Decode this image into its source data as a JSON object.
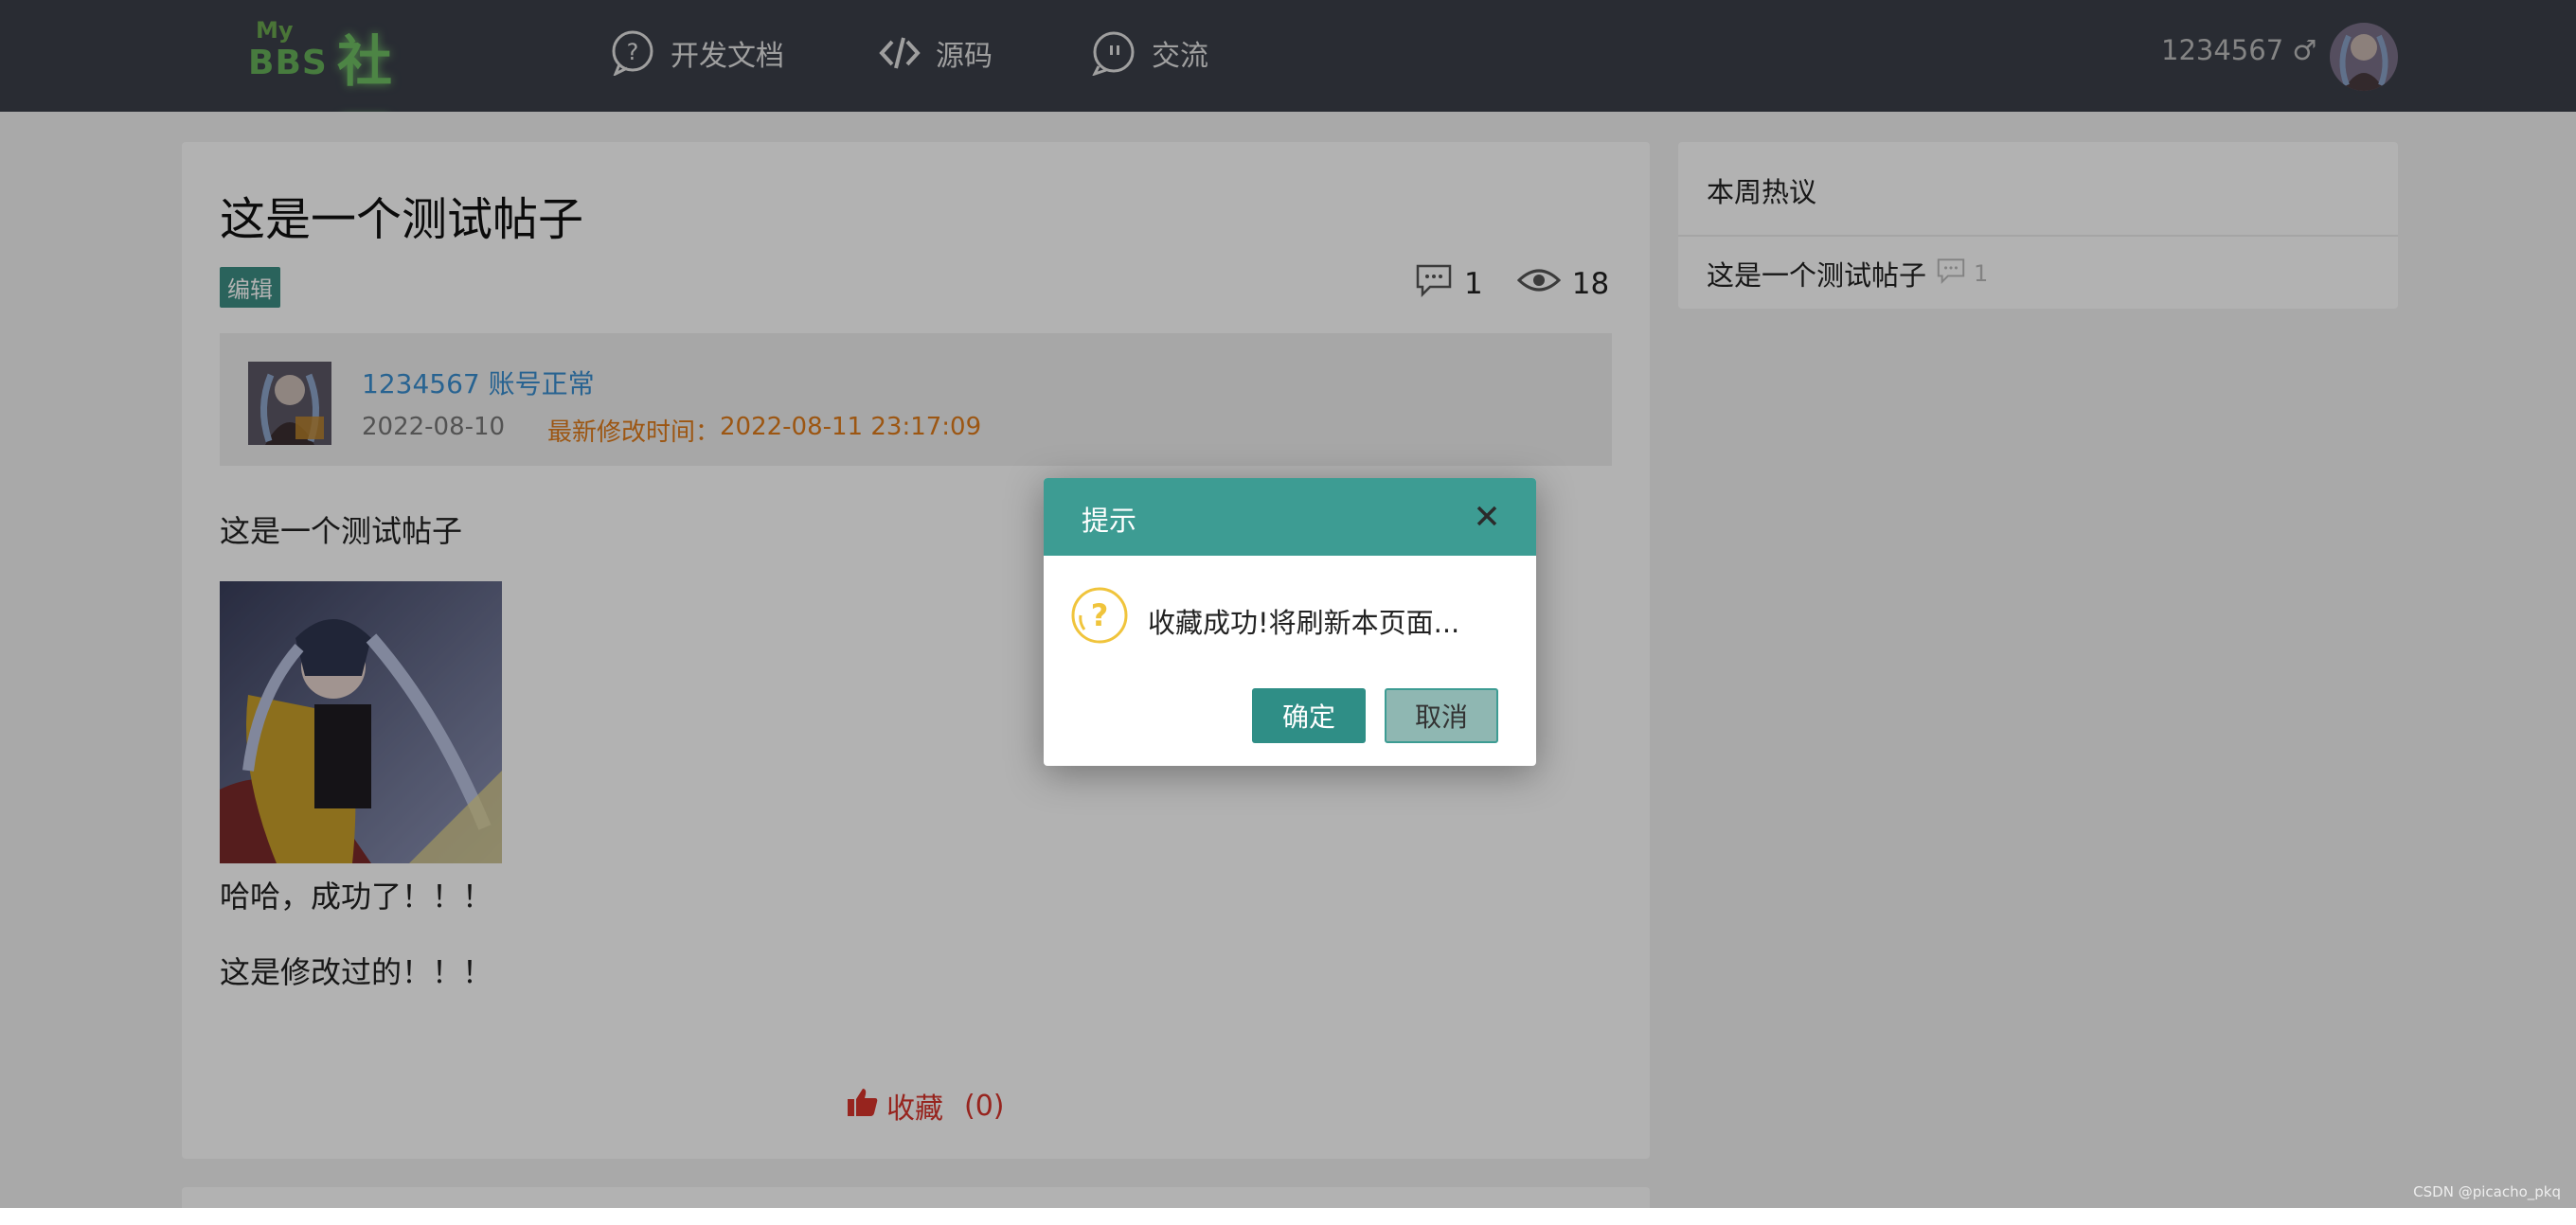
{
  "header": {
    "logo_my": "My",
    "logo_bbs": "BBS",
    "logo_cn": "社区",
    "nav": [
      {
        "label": "开发文档",
        "icon": "question-bubble-icon"
      },
      {
        "label": "源码",
        "icon": "code-icon"
      },
      {
        "label": "交流",
        "icon": "chat-icon"
      }
    ],
    "username": "1234567 ♂"
  },
  "post": {
    "title": "这是一个测试帖子",
    "edit_tag": "编辑",
    "comment_count": "1",
    "view_count": "18",
    "author": {
      "name_status": "1234567 账号正常",
      "created": "2022-08-10",
      "modified_label": "最新修改时间：",
      "modified": "2022-08-11 23:17:09"
    },
    "content": {
      "para1": "这是一个测试帖子",
      "para2": "哈哈，成功了！！！",
      "para3": "这是修改过的！！！"
    },
    "favorite_label": "收藏",
    "favorite_count": "(0)"
  },
  "sidebar": {
    "title": "本周热议",
    "items": [
      {
        "title": "这是一个测试帖子",
        "comments": "1"
      }
    ]
  },
  "modal": {
    "title": "提示",
    "message": "收藏成功!将刷新本页面...",
    "ok_label": "确定",
    "cancel_label": "取消"
  },
  "watermark": "CSDN @picacho_pkq",
  "colors": {
    "topbar": "#3b3f4a",
    "accent": "#3d9c93",
    "favorite": "#d9342b",
    "link": "#3a8fd0",
    "modified": "#e07b1a"
  }
}
